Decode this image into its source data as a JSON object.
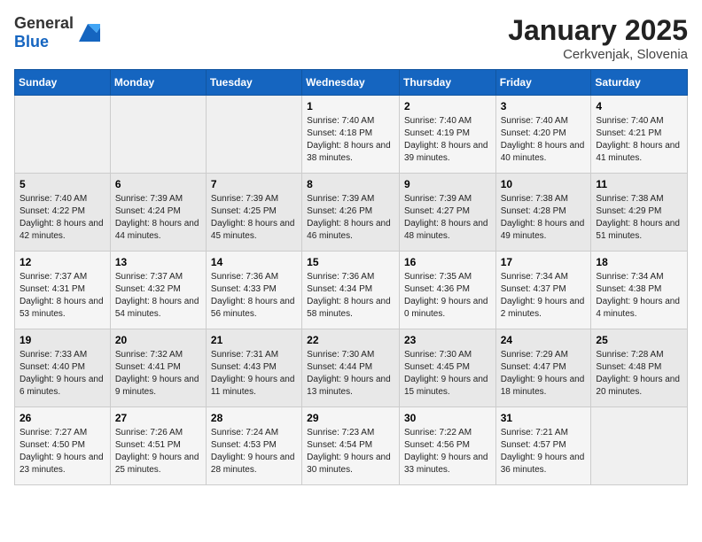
{
  "header": {
    "logo_general": "General",
    "logo_blue": "Blue",
    "title": "January 2025",
    "location": "Cerkvenjak, Slovenia"
  },
  "weekdays": [
    "Sunday",
    "Monday",
    "Tuesday",
    "Wednesday",
    "Thursday",
    "Friday",
    "Saturday"
  ],
  "weeks": [
    [
      {
        "day": "",
        "info": ""
      },
      {
        "day": "",
        "info": ""
      },
      {
        "day": "",
        "info": ""
      },
      {
        "day": "1",
        "info": "Sunrise: 7:40 AM\nSunset: 4:18 PM\nDaylight: 8 hours and 38 minutes."
      },
      {
        "day": "2",
        "info": "Sunrise: 7:40 AM\nSunset: 4:19 PM\nDaylight: 8 hours and 39 minutes."
      },
      {
        "day": "3",
        "info": "Sunrise: 7:40 AM\nSunset: 4:20 PM\nDaylight: 8 hours and 40 minutes."
      },
      {
        "day": "4",
        "info": "Sunrise: 7:40 AM\nSunset: 4:21 PM\nDaylight: 8 hours and 41 minutes."
      }
    ],
    [
      {
        "day": "5",
        "info": "Sunrise: 7:40 AM\nSunset: 4:22 PM\nDaylight: 8 hours and 42 minutes."
      },
      {
        "day": "6",
        "info": "Sunrise: 7:39 AM\nSunset: 4:24 PM\nDaylight: 8 hours and 44 minutes."
      },
      {
        "day": "7",
        "info": "Sunrise: 7:39 AM\nSunset: 4:25 PM\nDaylight: 8 hours and 45 minutes."
      },
      {
        "day": "8",
        "info": "Sunrise: 7:39 AM\nSunset: 4:26 PM\nDaylight: 8 hours and 46 minutes."
      },
      {
        "day": "9",
        "info": "Sunrise: 7:39 AM\nSunset: 4:27 PM\nDaylight: 8 hours and 48 minutes."
      },
      {
        "day": "10",
        "info": "Sunrise: 7:38 AM\nSunset: 4:28 PM\nDaylight: 8 hours and 49 minutes."
      },
      {
        "day": "11",
        "info": "Sunrise: 7:38 AM\nSunset: 4:29 PM\nDaylight: 8 hours and 51 minutes."
      }
    ],
    [
      {
        "day": "12",
        "info": "Sunrise: 7:37 AM\nSunset: 4:31 PM\nDaylight: 8 hours and 53 minutes."
      },
      {
        "day": "13",
        "info": "Sunrise: 7:37 AM\nSunset: 4:32 PM\nDaylight: 8 hours and 54 minutes."
      },
      {
        "day": "14",
        "info": "Sunrise: 7:36 AM\nSunset: 4:33 PM\nDaylight: 8 hours and 56 minutes."
      },
      {
        "day": "15",
        "info": "Sunrise: 7:36 AM\nSunset: 4:34 PM\nDaylight: 8 hours and 58 minutes."
      },
      {
        "day": "16",
        "info": "Sunrise: 7:35 AM\nSunset: 4:36 PM\nDaylight: 9 hours and 0 minutes."
      },
      {
        "day": "17",
        "info": "Sunrise: 7:34 AM\nSunset: 4:37 PM\nDaylight: 9 hours and 2 minutes."
      },
      {
        "day": "18",
        "info": "Sunrise: 7:34 AM\nSunset: 4:38 PM\nDaylight: 9 hours and 4 minutes."
      }
    ],
    [
      {
        "day": "19",
        "info": "Sunrise: 7:33 AM\nSunset: 4:40 PM\nDaylight: 9 hours and 6 minutes."
      },
      {
        "day": "20",
        "info": "Sunrise: 7:32 AM\nSunset: 4:41 PM\nDaylight: 9 hours and 9 minutes."
      },
      {
        "day": "21",
        "info": "Sunrise: 7:31 AM\nSunset: 4:43 PM\nDaylight: 9 hours and 11 minutes."
      },
      {
        "day": "22",
        "info": "Sunrise: 7:30 AM\nSunset: 4:44 PM\nDaylight: 9 hours and 13 minutes."
      },
      {
        "day": "23",
        "info": "Sunrise: 7:30 AM\nSunset: 4:45 PM\nDaylight: 9 hours and 15 minutes."
      },
      {
        "day": "24",
        "info": "Sunrise: 7:29 AM\nSunset: 4:47 PM\nDaylight: 9 hours and 18 minutes."
      },
      {
        "day": "25",
        "info": "Sunrise: 7:28 AM\nSunset: 4:48 PM\nDaylight: 9 hours and 20 minutes."
      }
    ],
    [
      {
        "day": "26",
        "info": "Sunrise: 7:27 AM\nSunset: 4:50 PM\nDaylight: 9 hours and 23 minutes."
      },
      {
        "day": "27",
        "info": "Sunrise: 7:26 AM\nSunset: 4:51 PM\nDaylight: 9 hours and 25 minutes."
      },
      {
        "day": "28",
        "info": "Sunrise: 7:24 AM\nSunset: 4:53 PM\nDaylight: 9 hours and 28 minutes."
      },
      {
        "day": "29",
        "info": "Sunrise: 7:23 AM\nSunset: 4:54 PM\nDaylight: 9 hours and 30 minutes."
      },
      {
        "day": "30",
        "info": "Sunrise: 7:22 AM\nSunset: 4:56 PM\nDaylight: 9 hours and 33 minutes."
      },
      {
        "day": "31",
        "info": "Sunrise: 7:21 AM\nSunset: 4:57 PM\nDaylight: 9 hours and 36 minutes."
      },
      {
        "day": "",
        "info": ""
      }
    ]
  ]
}
